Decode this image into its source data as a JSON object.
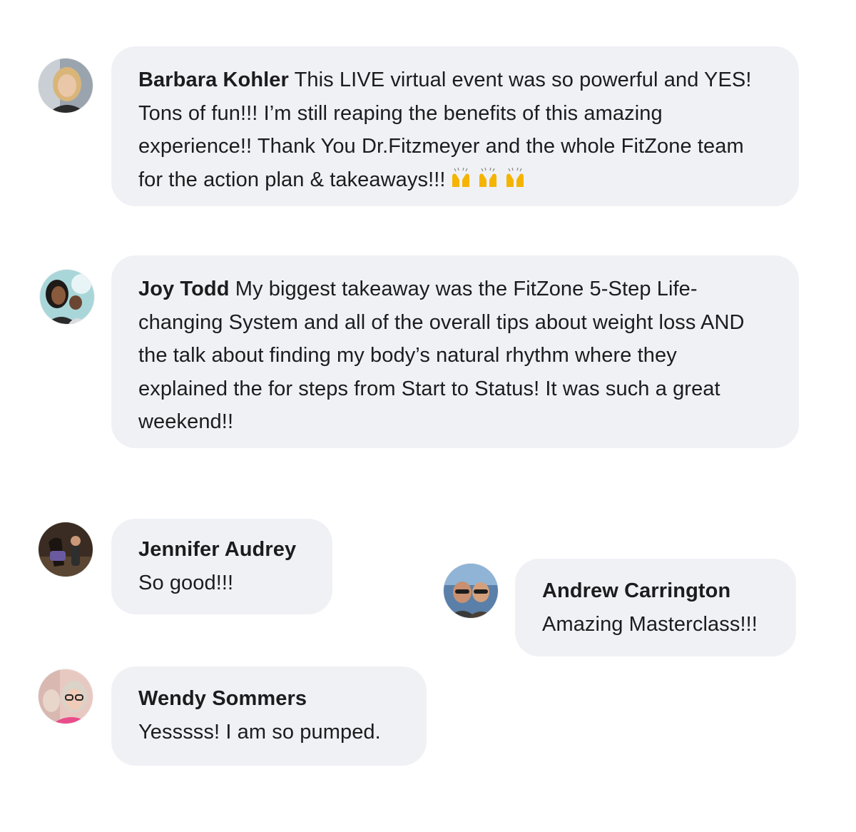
{
  "comments": [
    {
      "name": "Barbara Kohler",
      "text": "This LIVE virtual event was so powerful and YES! Tons of fun!!! I’m still reaping the benefits of this amazing experience!! Thank You Dr.Fitzmeyer and the whole FitZone team for the action plan & takeaways!!!",
      "emoji": "raising-hands-emoji",
      "avatar_icon": "woman-blonde-avatar"
    },
    {
      "name": "Joy Todd",
      "text": "My biggest takeaway was the FitZone 5-Step Life-changing System and all of the overall tips about weight loss AND the talk about finding my body’s natural rhythm where they explained the for steps from Start to Status! It was such a great weekend!!",
      "avatar_icon": "woman-with-child-avatar"
    },
    {
      "name": "Jennifer Audrey",
      "text": "So good!!!",
      "avatar_icon": "woman-with-horse-avatar"
    },
    {
      "name": "Andrew Carrington",
      "text": "Amazing Masterclass!!!",
      "avatar_icon": "couple-sunglasses-avatar"
    },
    {
      "name": "Wendy Sommers",
      "text": "Yesssss! I am so pumped.",
      "avatar_icon": "woman-glasses-avatar"
    }
  ],
  "colors": {
    "bubble_bg": "#f0f1f5",
    "text": "#1c1c1e"
  }
}
